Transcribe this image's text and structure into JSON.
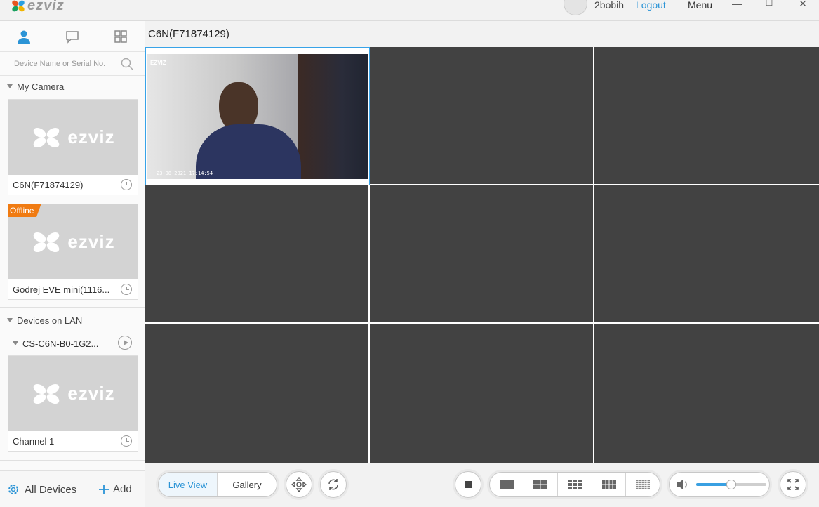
{
  "titlebar": {
    "logo": "ezviz",
    "username": "2bobih",
    "logout_label": "Logout",
    "menu_label": "Menu",
    "minimize": "—",
    "maximize": "☐",
    "close": "✕"
  },
  "sidebar": {
    "tabs": [
      "person-icon",
      "chat-icon",
      "grid-icon"
    ],
    "search_placeholder": "Device Name or Serial No.",
    "my_camera_label": "My Camera",
    "cameras": [
      {
        "name": "C6N(F71874129)",
        "offline": false
      },
      {
        "name": "Godrej EVE mini(1116...",
        "offline": true,
        "badge": "Offline"
      }
    ],
    "lan_label": "Devices on LAN",
    "lan_device": "CS-C6N-B0-1G2...",
    "lan_channel": "Channel 1",
    "thumb_logo": "ezviz",
    "all_devices_label": "All Devices",
    "add_label": "Add"
  },
  "main": {
    "title": "C6N(F71874129)",
    "video": {
      "osd_logo": "EZVIZ",
      "osd_time": "23-08-2021  17:14:54"
    }
  },
  "toolbar": {
    "live_view_label": "Live View",
    "gallery_label": "Gallery",
    "volume": 0.5,
    "accent": "#2b94d6"
  }
}
